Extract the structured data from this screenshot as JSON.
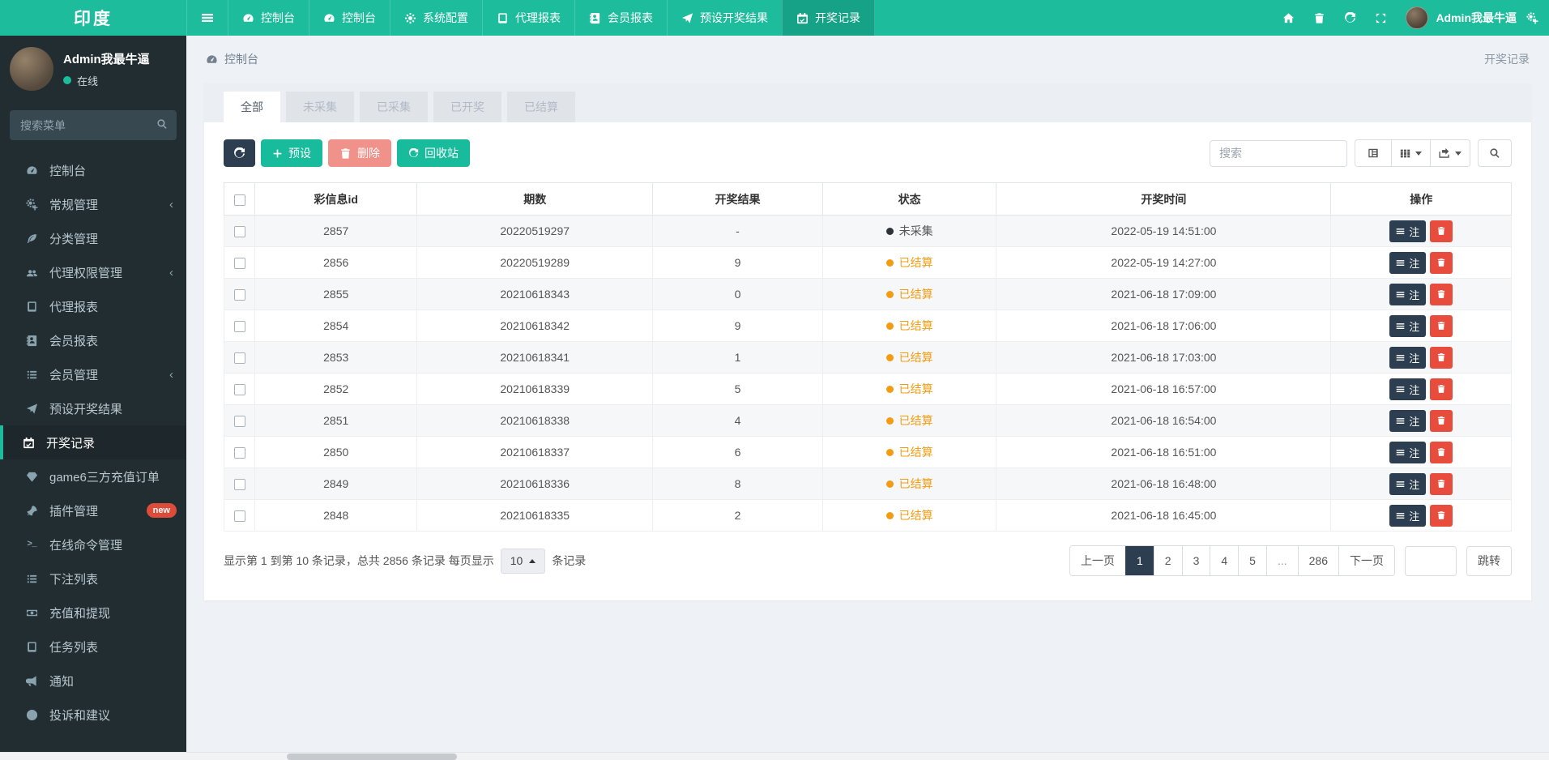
{
  "navbar": {
    "brand": "印度",
    "items": [
      {
        "icon": "dashboard",
        "label": "控制台",
        "active": false
      },
      {
        "icon": "dashboard",
        "label": "控制台",
        "active": false
      },
      {
        "icon": "gear",
        "label": "系统配置",
        "active": false
      },
      {
        "icon": "book",
        "label": "代理报表",
        "active": false
      },
      {
        "icon": "address-book",
        "label": "会员报表",
        "active": false
      },
      {
        "icon": "send",
        "label": "预设开奖结果",
        "active": false
      },
      {
        "icon": "calendar",
        "label": "开奖记录",
        "active": true
      }
    ],
    "right_icons": [
      "home",
      "trash",
      "sync",
      "expand"
    ],
    "user_name": "Admin我最牛逼"
  },
  "sidebar": {
    "user": {
      "name": "Admin我最牛逼",
      "status": "在线"
    },
    "search_placeholder": "搜索菜单",
    "items": [
      {
        "icon": "dashboard",
        "label": "控制台"
      },
      {
        "icon": "gears",
        "label": "常规管理",
        "chevron": true
      },
      {
        "icon": "leaf",
        "label": "分类管理"
      },
      {
        "icon": "users",
        "label": "代理权限管理",
        "chevron": true
      },
      {
        "icon": "book",
        "label": "代理报表"
      },
      {
        "icon": "address-book",
        "label": "会员报表"
      },
      {
        "icon": "list",
        "label": "会员管理",
        "chevron": true
      },
      {
        "icon": "send",
        "label": "预设开奖结果"
      },
      {
        "icon": "calendar",
        "label": "开奖记录",
        "active": true
      },
      {
        "icon": "gem",
        "label": "game6三方充值订单"
      },
      {
        "icon": "rocket",
        "label": "插件管理",
        "badge": "new"
      },
      {
        "icon": "terminal",
        "label": "在线命令管理"
      },
      {
        "icon": "list",
        "label": "下注列表"
      },
      {
        "icon": "money",
        "label": "充值和提现"
      },
      {
        "icon": "book",
        "label": "任务列表"
      },
      {
        "icon": "bullhorn",
        "label": "通知"
      },
      {
        "icon": "info",
        "label": "投诉和建议"
      }
    ]
  },
  "breadcrumb": {
    "left": "控制台",
    "right": "开奖记录"
  },
  "tabs": [
    {
      "label": "全部",
      "active": true
    },
    {
      "label": "未采集",
      "active": false
    },
    {
      "label": "已采集",
      "active": false
    },
    {
      "label": "已开奖",
      "active": false
    },
    {
      "label": "已结算",
      "active": false
    }
  ],
  "toolbar": {
    "preset_label": "预设",
    "delete_label": "删除",
    "recycle_label": "回收站",
    "search_placeholder": "搜索"
  },
  "table": {
    "columns": [
      "彩信息id",
      "期数",
      "开奖结果",
      "状态",
      "开奖时间",
      "操作"
    ],
    "note_label": "注",
    "rows": [
      {
        "id": "2857",
        "issue": "20220519297",
        "result": "-",
        "status": "未采集",
        "status_type": "pending",
        "time": "2022-05-19 14:51:00"
      },
      {
        "id": "2856",
        "issue": "20220519289",
        "result": "9",
        "status": "已结算",
        "status_type": "settled",
        "time": "2022-05-19 14:27:00"
      },
      {
        "id": "2855",
        "issue": "20210618343",
        "result": "0",
        "status": "已结算",
        "status_type": "settled",
        "time": "2021-06-18 17:09:00"
      },
      {
        "id": "2854",
        "issue": "20210618342",
        "result": "9",
        "status": "已结算",
        "status_type": "settled",
        "time": "2021-06-18 17:06:00"
      },
      {
        "id": "2853",
        "issue": "20210618341",
        "result": "1",
        "status": "已结算",
        "status_type": "settled",
        "time": "2021-06-18 17:03:00"
      },
      {
        "id": "2852",
        "issue": "20210618339",
        "result": "5",
        "status": "已结算",
        "status_type": "settled",
        "time": "2021-06-18 16:57:00"
      },
      {
        "id": "2851",
        "issue": "20210618338",
        "result": "4",
        "status": "已结算",
        "status_type": "settled",
        "time": "2021-06-18 16:54:00"
      },
      {
        "id": "2850",
        "issue": "20210618337",
        "result": "6",
        "status": "已结算",
        "status_type": "settled",
        "time": "2021-06-18 16:51:00"
      },
      {
        "id": "2849",
        "issue": "20210618336",
        "result": "8",
        "status": "已结算",
        "status_type": "settled",
        "time": "2021-06-18 16:48:00"
      },
      {
        "id": "2848",
        "issue": "20210618335",
        "result": "2",
        "status": "已结算",
        "status_type": "settled",
        "time": "2021-06-18 16:45:00"
      }
    ]
  },
  "footer": {
    "summary_prefix": "显示第 1 到第 10 条记录，总共 2856 条记录 每页显示",
    "page_size": "10",
    "summary_suffix": "条记录",
    "pages": [
      {
        "label": "上一页"
      },
      {
        "label": "1",
        "active": true
      },
      {
        "label": "2"
      },
      {
        "label": "3"
      },
      {
        "label": "4"
      },
      {
        "label": "5"
      },
      {
        "label": "...",
        "dots": true
      },
      {
        "label": "286"
      },
      {
        "label": "下一页"
      }
    ],
    "jump_label": "跳转"
  },
  "colors": {
    "accent_teal": "#1dbc9c",
    "navbar_active": "#16a287",
    "sidebar_bg": "#222d32",
    "dark_navy": "#2c3e50",
    "green_btn": "#18bc9c",
    "salmon_btn": "#f0918a",
    "danger_red": "#e74c3c",
    "status_orange": "#f39c12",
    "badge_red": "#dd4b39"
  }
}
